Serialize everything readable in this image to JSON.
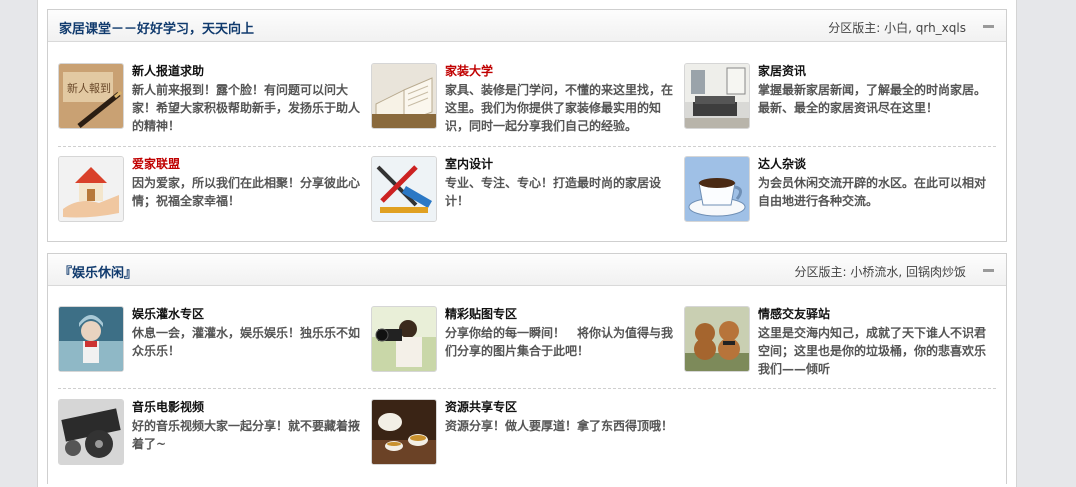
{
  "sections": [
    {
      "title": "家居课堂－－好好学习，天天向上",
      "moderators": "分区版主: 小白, qrh_xqls",
      "forums": [
        {
          "name": "新人报道求助",
          "desc": "新人前来报到！露个脸！有问题可以问大家！希望大家积极帮助新手，发扬乐于助人的精神！"
        },
        {
          "name": "家装大学",
          "desc": "家具、装修是门学问，不懂的来这里找，在这里。我们为你提供了家装修最实用的知识，同时一起分享我们自己的经验。"
        },
        {
          "name": "家居资讯",
          "desc": "掌握最新家居新闻，了解最全的时尚家居。最新、最全的家居资讯尽在这里！"
        },
        {
          "name": "爱家联盟",
          "desc": "因为爱家，所以我们在此相聚！分享彼此心情；祝福全家幸福！"
        },
        {
          "name": "室内设计",
          "desc": "专业、专注、专心！打造最时尚的家居设计！"
        },
        {
          "name": "达人杂谈",
          "desc": "为会员休闲交流开辟的水区。在此可以相对自由地进行各种交流。"
        }
      ]
    },
    {
      "title": "『娱乐休闲』",
      "moderators": "分区版主: 小桥流水, 回锅肉炒饭",
      "forums": [
        {
          "name": "娱乐灌水专区",
          "desc": "休息一会，灌灌水，娱乐娱乐！独乐乐不如众乐乐！"
        },
        {
          "name": "精彩贴图专区",
          "desc": "分享你给的每一瞬间！　将你认为值得与我们分享的图片集合于此吧！"
        },
        {
          "name": "情感交友驿站",
          "desc": "这里是交海内知己，成就了天下谁人不识君空间；这里也是你的垃圾桶，你的悲喜欢乐我们——倾听"
        },
        {
          "name": "音乐电影视频",
          "desc": "好的音乐视频大家一起分享！就不要藏着掖着了~"
        },
        {
          "name": "资源共享专区",
          "desc": "资源分享！做人要厚道！拿了东西得顶哦！"
        }
      ]
    }
  ],
  "thumbnail_icons": [
    "pen-calligraphy-icon",
    "open-book-icon",
    "living-room-icon",
    "house-in-hand-icon",
    "design-tools-icon",
    "coffee-cup-icon",
    "anime-character-icon",
    "photographer-icon",
    "poodle-dogs-icon",
    "film-reel-icon",
    "tea-set-icon"
  ],
  "colors": {
    "title": "#113b6e",
    "highlight_name": "#c00000",
    "text": "#555555",
    "border": "#cfcfcf"
  }
}
